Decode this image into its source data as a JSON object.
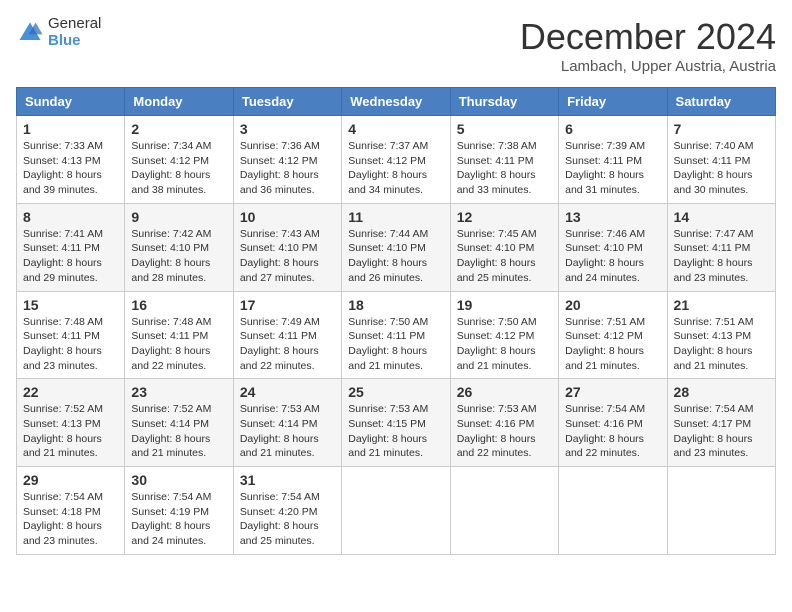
{
  "header": {
    "logo_general": "General",
    "logo_blue": "Blue",
    "month_title": "December 2024",
    "location": "Lambach, Upper Austria, Austria"
  },
  "calendar": {
    "days_of_week": [
      "Sunday",
      "Monday",
      "Tuesday",
      "Wednesday",
      "Thursday",
      "Friday",
      "Saturday"
    ],
    "weeks": [
      [
        {
          "day": 1,
          "sunrise": "7:33 AM",
          "sunset": "4:13 PM",
          "daylight": "8 hours and 39 minutes."
        },
        {
          "day": 2,
          "sunrise": "7:34 AM",
          "sunset": "4:12 PM",
          "daylight": "8 hours and 38 minutes."
        },
        {
          "day": 3,
          "sunrise": "7:36 AM",
          "sunset": "4:12 PM",
          "daylight": "8 hours and 36 minutes."
        },
        {
          "day": 4,
          "sunrise": "7:37 AM",
          "sunset": "4:12 PM",
          "daylight": "8 hours and 34 minutes."
        },
        {
          "day": 5,
          "sunrise": "7:38 AM",
          "sunset": "4:11 PM",
          "daylight": "8 hours and 33 minutes."
        },
        {
          "day": 6,
          "sunrise": "7:39 AM",
          "sunset": "4:11 PM",
          "daylight": "8 hours and 31 minutes."
        },
        {
          "day": 7,
          "sunrise": "7:40 AM",
          "sunset": "4:11 PM",
          "daylight": "8 hours and 30 minutes."
        }
      ],
      [
        {
          "day": 8,
          "sunrise": "7:41 AM",
          "sunset": "4:11 PM",
          "daylight": "8 hours and 29 minutes."
        },
        {
          "day": 9,
          "sunrise": "7:42 AM",
          "sunset": "4:10 PM",
          "daylight": "8 hours and 28 minutes."
        },
        {
          "day": 10,
          "sunrise": "7:43 AM",
          "sunset": "4:10 PM",
          "daylight": "8 hours and 27 minutes."
        },
        {
          "day": 11,
          "sunrise": "7:44 AM",
          "sunset": "4:10 PM",
          "daylight": "8 hours and 26 minutes."
        },
        {
          "day": 12,
          "sunrise": "7:45 AM",
          "sunset": "4:10 PM",
          "daylight": "8 hours and 25 minutes."
        },
        {
          "day": 13,
          "sunrise": "7:46 AM",
          "sunset": "4:10 PM",
          "daylight": "8 hours and 24 minutes."
        },
        {
          "day": 14,
          "sunrise": "7:47 AM",
          "sunset": "4:11 PM",
          "daylight": "8 hours and 23 minutes."
        }
      ],
      [
        {
          "day": 15,
          "sunrise": "7:48 AM",
          "sunset": "4:11 PM",
          "daylight": "8 hours and 23 minutes."
        },
        {
          "day": 16,
          "sunrise": "7:48 AM",
          "sunset": "4:11 PM",
          "daylight": "8 hours and 22 minutes."
        },
        {
          "day": 17,
          "sunrise": "7:49 AM",
          "sunset": "4:11 PM",
          "daylight": "8 hours and 22 minutes."
        },
        {
          "day": 18,
          "sunrise": "7:50 AM",
          "sunset": "4:11 PM",
          "daylight": "8 hours and 21 minutes."
        },
        {
          "day": 19,
          "sunrise": "7:50 AM",
          "sunset": "4:12 PM",
          "daylight": "8 hours and 21 minutes."
        },
        {
          "day": 20,
          "sunrise": "7:51 AM",
          "sunset": "4:12 PM",
          "daylight": "8 hours and 21 minutes."
        },
        {
          "day": 21,
          "sunrise": "7:51 AM",
          "sunset": "4:13 PM",
          "daylight": "8 hours and 21 minutes."
        }
      ],
      [
        {
          "day": 22,
          "sunrise": "7:52 AM",
          "sunset": "4:13 PM",
          "daylight": "8 hours and 21 minutes."
        },
        {
          "day": 23,
          "sunrise": "7:52 AM",
          "sunset": "4:14 PM",
          "daylight": "8 hours and 21 minutes."
        },
        {
          "day": 24,
          "sunrise": "7:53 AM",
          "sunset": "4:14 PM",
          "daylight": "8 hours and 21 minutes."
        },
        {
          "day": 25,
          "sunrise": "7:53 AM",
          "sunset": "4:15 PM",
          "daylight": "8 hours and 21 minutes."
        },
        {
          "day": 26,
          "sunrise": "7:53 AM",
          "sunset": "4:16 PM",
          "daylight": "8 hours and 22 minutes."
        },
        {
          "day": 27,
          "sunrise": "7:54 AM",
          "sunset": "4:16 PM",
          "daylight": "8 hours and 22 minutes."
        },
        {
          "day": 28,
          "sunrise": "7:54 AM",
          "sunset": "4:17 PM",
          "daylight": "8 hours and 23 minutes."
        }
      ],
      [
        {
          "day": 29,
          "sunrise": "7:54 AM",
          "sunset": "4:18 PM",
          "daylight": "8 hours and 23 minutes."
        },
        {
          "day": 30,
          "sunrise": "7:54 AM",
          "sunset": "4:19 PM",
          "daylight": "8 hours and 24 minutes."
        },
        {
          "day": 31,
          "sunrise": "7:54 AM",
          "sunset": "4:20 PM",
          "daylight": "8 hours and 25 minutes."
        },
        null,
        null,
        null,
        null
      ]
    ]
  }
}
